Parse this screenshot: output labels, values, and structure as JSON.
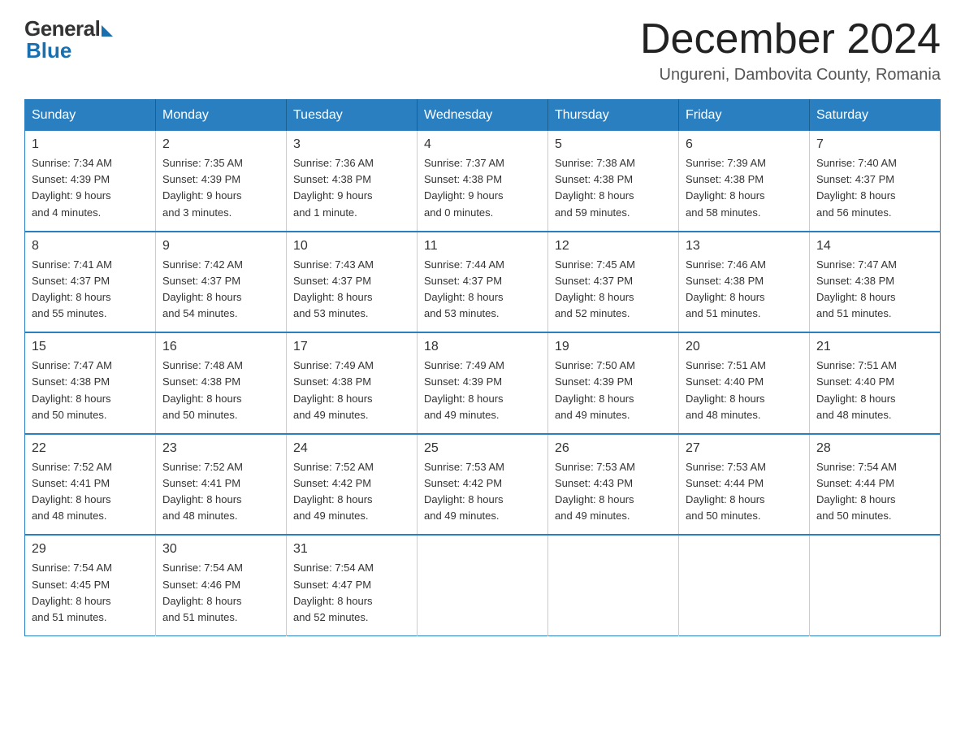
{
  "logo": {
    "general": "General",
    "blue": "Blue"
  },
  "title": {
    "month_year": "December 2024",
    "location": "Ungureni, Dambovita County, Romania"
  },
  "days_of_week": [
    "Sunday",
    "Monday",
    "Tuesday",
    "Wednesday",
    "Thursday",
    "Friday",
    "Saturday"
  ],
  "weeks": [
    [
      {
        "day": "1",
        "sunrise": "7:34 AM",
        "sunset": "4:39 PM",
        "daylight": "9 hours and 4 minutes."
      },
      {
        "day": "2",
        "sunrise": "7:35 AM",
        "sunset": "4:39 PM",
        "daylight": "9 hours and 3 minutes."
      },
      {
        "day": "3",
        "sunrise": "7:36 AM",
        "sunset": "4:38 PM",
        "daylight": "9 hours and 1 minute."
      },
      {
        "day": "4",
        "sunrise": "7:37 AM",
        "sunset": "4:38 PM",
        "daylight": "9 hours and 0 minutes."
      },
      {
        "day": "5",
        "sunrise": "7:38 AM",
        "sunset": "4:38 PM",
        "daylight": "8 hours and 59 minutes."
      },
      {
        "day": "6",
        "sunrise": "7:39 AM",
        "sunset": "4:38 PM",
        "daylight": "8 hours and 58 minutes."
      },
      {
        "day": "7",
        "sunrise": "7:40 AM",
        "sunset": "4:37 PM",
        "daylight": "8 hours and 56 minutes."
      }
    ],
    [
      {
        "day": "8",
        "sunrise": "7:41 AM",
        "sunset": "4:37 PM",
        "daylight": "8 hours and 55 minutes."
      },
      {
        "day": "9",
        "sunrise": "7:42 AM",
        "sunset": "4:37 PM",
        "daylight": "8 hours and 54 minutes."
      },
      {
        "day": "10",
        "sunrise": "7:43 AM",
        "sunset": "4:37 PM",
        "daylight": "8 hours and 53 minutes."
      },
      {
        "day": "11",
        "sunrise": "7:44 AM",
        "sunset": "4:37 PM",
        "daylight": "8 hours and 53 minutes."
      },
      {
        "day": "12",
        "sunrise": "7:45 AM",
        "sunset": "4:37 PM",
        "daylight": "8 hours and 52 minutes."
      },
      {
        "day": "13",
        "sunrise": "7:46 AM",
        "sunset": "4:38 PM",
        "daylight": "8 hours and 51 minutes."
      },
      {
        "day": "14",
        "sunrise": "7:47 AM",
        "sunset": "4:38 PM",
        "daylight": "8 hours and 51 minutes."
      }
    ],
    [
      {
        "day": "15",
        "sunrise": "7:47 AM",
        "sunset": "4:38 PM",
        "daylight": "8 hours and 50 minutes."
      },
      {
        "day": "16",
        "sunrise": "7:48 AM",
        "sunset": "4:38 PM",
        "daylight": "8 hours and 50 minutes."
      },
      {
        "day": "17",
        "sunrise": "7:49 AM",
        "sunset": "4:38 PM",
        "daylight": "8 hours and 49 minutes."
      },
      {
        "day": "18",
        "sunrise": "7:49 AM",
        "sunset": "4:39 PM",
        "daylight": "8 hours and 49 minutes."
      },
      {
        "day": "19",
        "sunrise": "7:50 AM",
        "sunset": "4:39 PM",
        "daylight": "8 hours and 49 minutes."
      },
      {
        "day": "20",
        "sunrise": "7:51 AM",
        "sunset": "4:40 PM",
        "daylight": "8 hours and 48 minutes."
      },
      {
        "day": "21",
        "sunrise": "7:51 AM",
        "sunset": "4:40 PM",
        "daylight": "8 hours and 48 minutes."
      }
    ],
    [
      {
        "day": "22",
        "sunrise": "7:52 AM",
        "sunset": "4:41 PM",
        "daylight": "8 hours and 48 minutes."
      },
      {
        "day": "23",
        "sunrise": "7:52 AM",
        "sunset": "4:41 PM",
        "daylight": "8 hours and 48 minutes."
      },
      {
        "day": "24",
        "sunrise": "7:52 AM",
        "sunset": "4:42 PM",
        "daylight": "8 hours and 49 minutes."
      },
      {
        "day": "25",
        "sunrise": "7:53 AM",
        "sunset": "4:42 PM",
        "daylight": "8 hours and 49 minutes."
      },
      {
        "day": "26",
        "sunrise": "7:53 AM",
        "sunset": "4:43 PM",
        "daylight": "8 hours and 49 minutes."
      },
      {
        "day": "27",
        "sunrise": "7:53 AM",
        "sunset": "4:44 PM",
        "daylight": "8 hours and 50 minutes."
      },
      {
        "day": "28",
        "sunrise": "7:54 AM",
        "sunset": "4:44 PM",
        "daylight": "8 hours and 50 minutes."
      }
    ],
    [
      {
        "day": "29",
        "sunrise": "7:54 AM",
        "sunset": "4:45 PM",
        "daylight": "8 hours and 51 minutes."
      },
      {
        "day": "30",
        "sunrise": "7:54 AM",
        "sunset": "4:46 PM",
        "daylight": "8 hours and 51 minutes."
      },
      {
        "day": "31",
        "sunrise": "7:54 AM",
        "sunset": "4:47 PM",
        "daylight": "8 hours and 52 minutes."
      },
      null,
      null,
      null,
      null
    ]
  ]
}
